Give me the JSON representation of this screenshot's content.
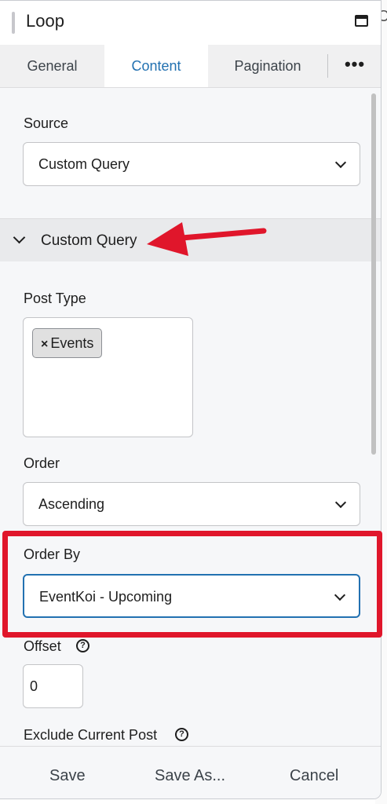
{
  "window": {
    "title": "Loop"
  },
  "tabs": [
    {
      "label": "General"
    },
    {
      "label": "Content"
    },
    {
      "label": "Pagination"
    },
    {
      "label": "•••"
    }
  ],
  "fields": {
    "source": {
      "label": "Source",
      "value": "Custom Query"
    },
    "section": {
      "label": "Custom Query"
    },
    "post_type": {
      "label": "Post Type",
      "tokens": [
        "Events"
      ],
      "remove_glyph": "×"
    },
    "order": {
      "label": "Order",
      "value": "Ascending"
    },
    "order_by": {
      "label": "Order By",
      "value": "EventKoi - Upcoming"
    },
    "offset": {
      "label": "Offset",
      "value": "0",
      "help": "?"
    },
    "exclude_current": {
      "label": "Exclude Current Post",
      "help": "?"
    }
  },
  "footer": {
    "save": "Save",
    "save_as": "Save As...",
    "cancel": "Cancel"
  },
  "colors": {
    "accent": "#2271b1",
    "annotation": "#e0162b"
  }
}
